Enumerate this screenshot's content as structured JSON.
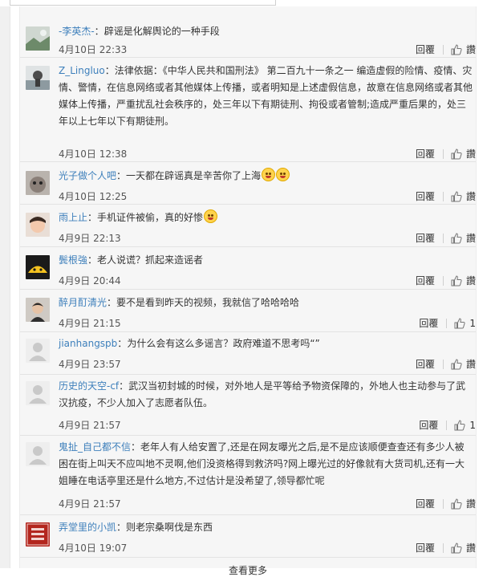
{
  "reply_label": "回覆",
  "like_label": "讚",
  "see_more": "查看更多",
  "comments": [
    {
      "name": "-李英杰-",
      "text": "辟谣是化解舆论的一种手段",
      "time": "4月10日 22:33",
      "likes": ""
    },
    {
      "name": "Z_Lingluo",
      "text": "法律依据：《中华人民共和国刑法》 第二百九十一条之一 编造虚假的险情、疫情、灾情、警情，在信息网络或者其他媒体上传播，或者明知是上述虚假信息，故意在信息网络或者其他媒体上传播，严重扰乱社会秩序的，处三年以下有期徒刑、拘役或者管制;造成严重后果的，处三年以上七年以下有期徒刑。",
      "time": "4月10日 12:38",
      "likes": ""
    },
    {
      "name": "光子做个人吧",
      "text": "一天都在辟谣真是辛苦你了上海",
      "time": "4月10日 12:25",
      "likes": ""
    },
    {
      "name": "雨上止",
      "text": "手机证件被偷，真的好惨",
      "time": "4月9日 22:13",
      "likes": ""
    },
    {
      "name": "鬓根強",
      "text": "老人说谎？抓起来造谣者",
      "time": "4月9日 20:44",
      "likes": ""
    },
    {
      "name": "醉月酊清光",
      "text": "要不是看到昨天的视频，我就信了哈哈哈哈",
      "time": "4月9日 21:15",
      "likes": "1"
    },
    {
      "name": "jianhangspb",
      "text": "为什么会有这么多谣言？政府难道不思考吗“”",
      "time": "4月9日 23:57",
      "likes": ""
    },
    {
      "name": "历史的天空-cf",
      "text": "武汉当初封城的时候，对外地人是平等给予物资保障的，外地人也主动参与了武汉抗疫，不少人加入了志愿者队伍。",
      "time": "4月9日 21:57",
      "likes": "1"
    },
    {
      "name": "鬼扯_自己都不信",
      "text": "老年人有人给安置了,还是在网友曝光之后,是不是应该顺便查查还有多少人被困在街上叫天不应叫地不灵啊,他们没资格得到救济吗?网上曝光过的好像就有大货司机,还有一大姐睡在电话亭里还是什么地方,不过估计是没希望了,领导都忙呢",
      "time": "4月9日 21:57",
      "likes": ""
    },
    {
      "name": "弄堂里的小凯",
      "text": "则老宗桑啊伐是东西",
      "time": "4月10日 19:07",
      "likes": ""
    }
  ]
}
